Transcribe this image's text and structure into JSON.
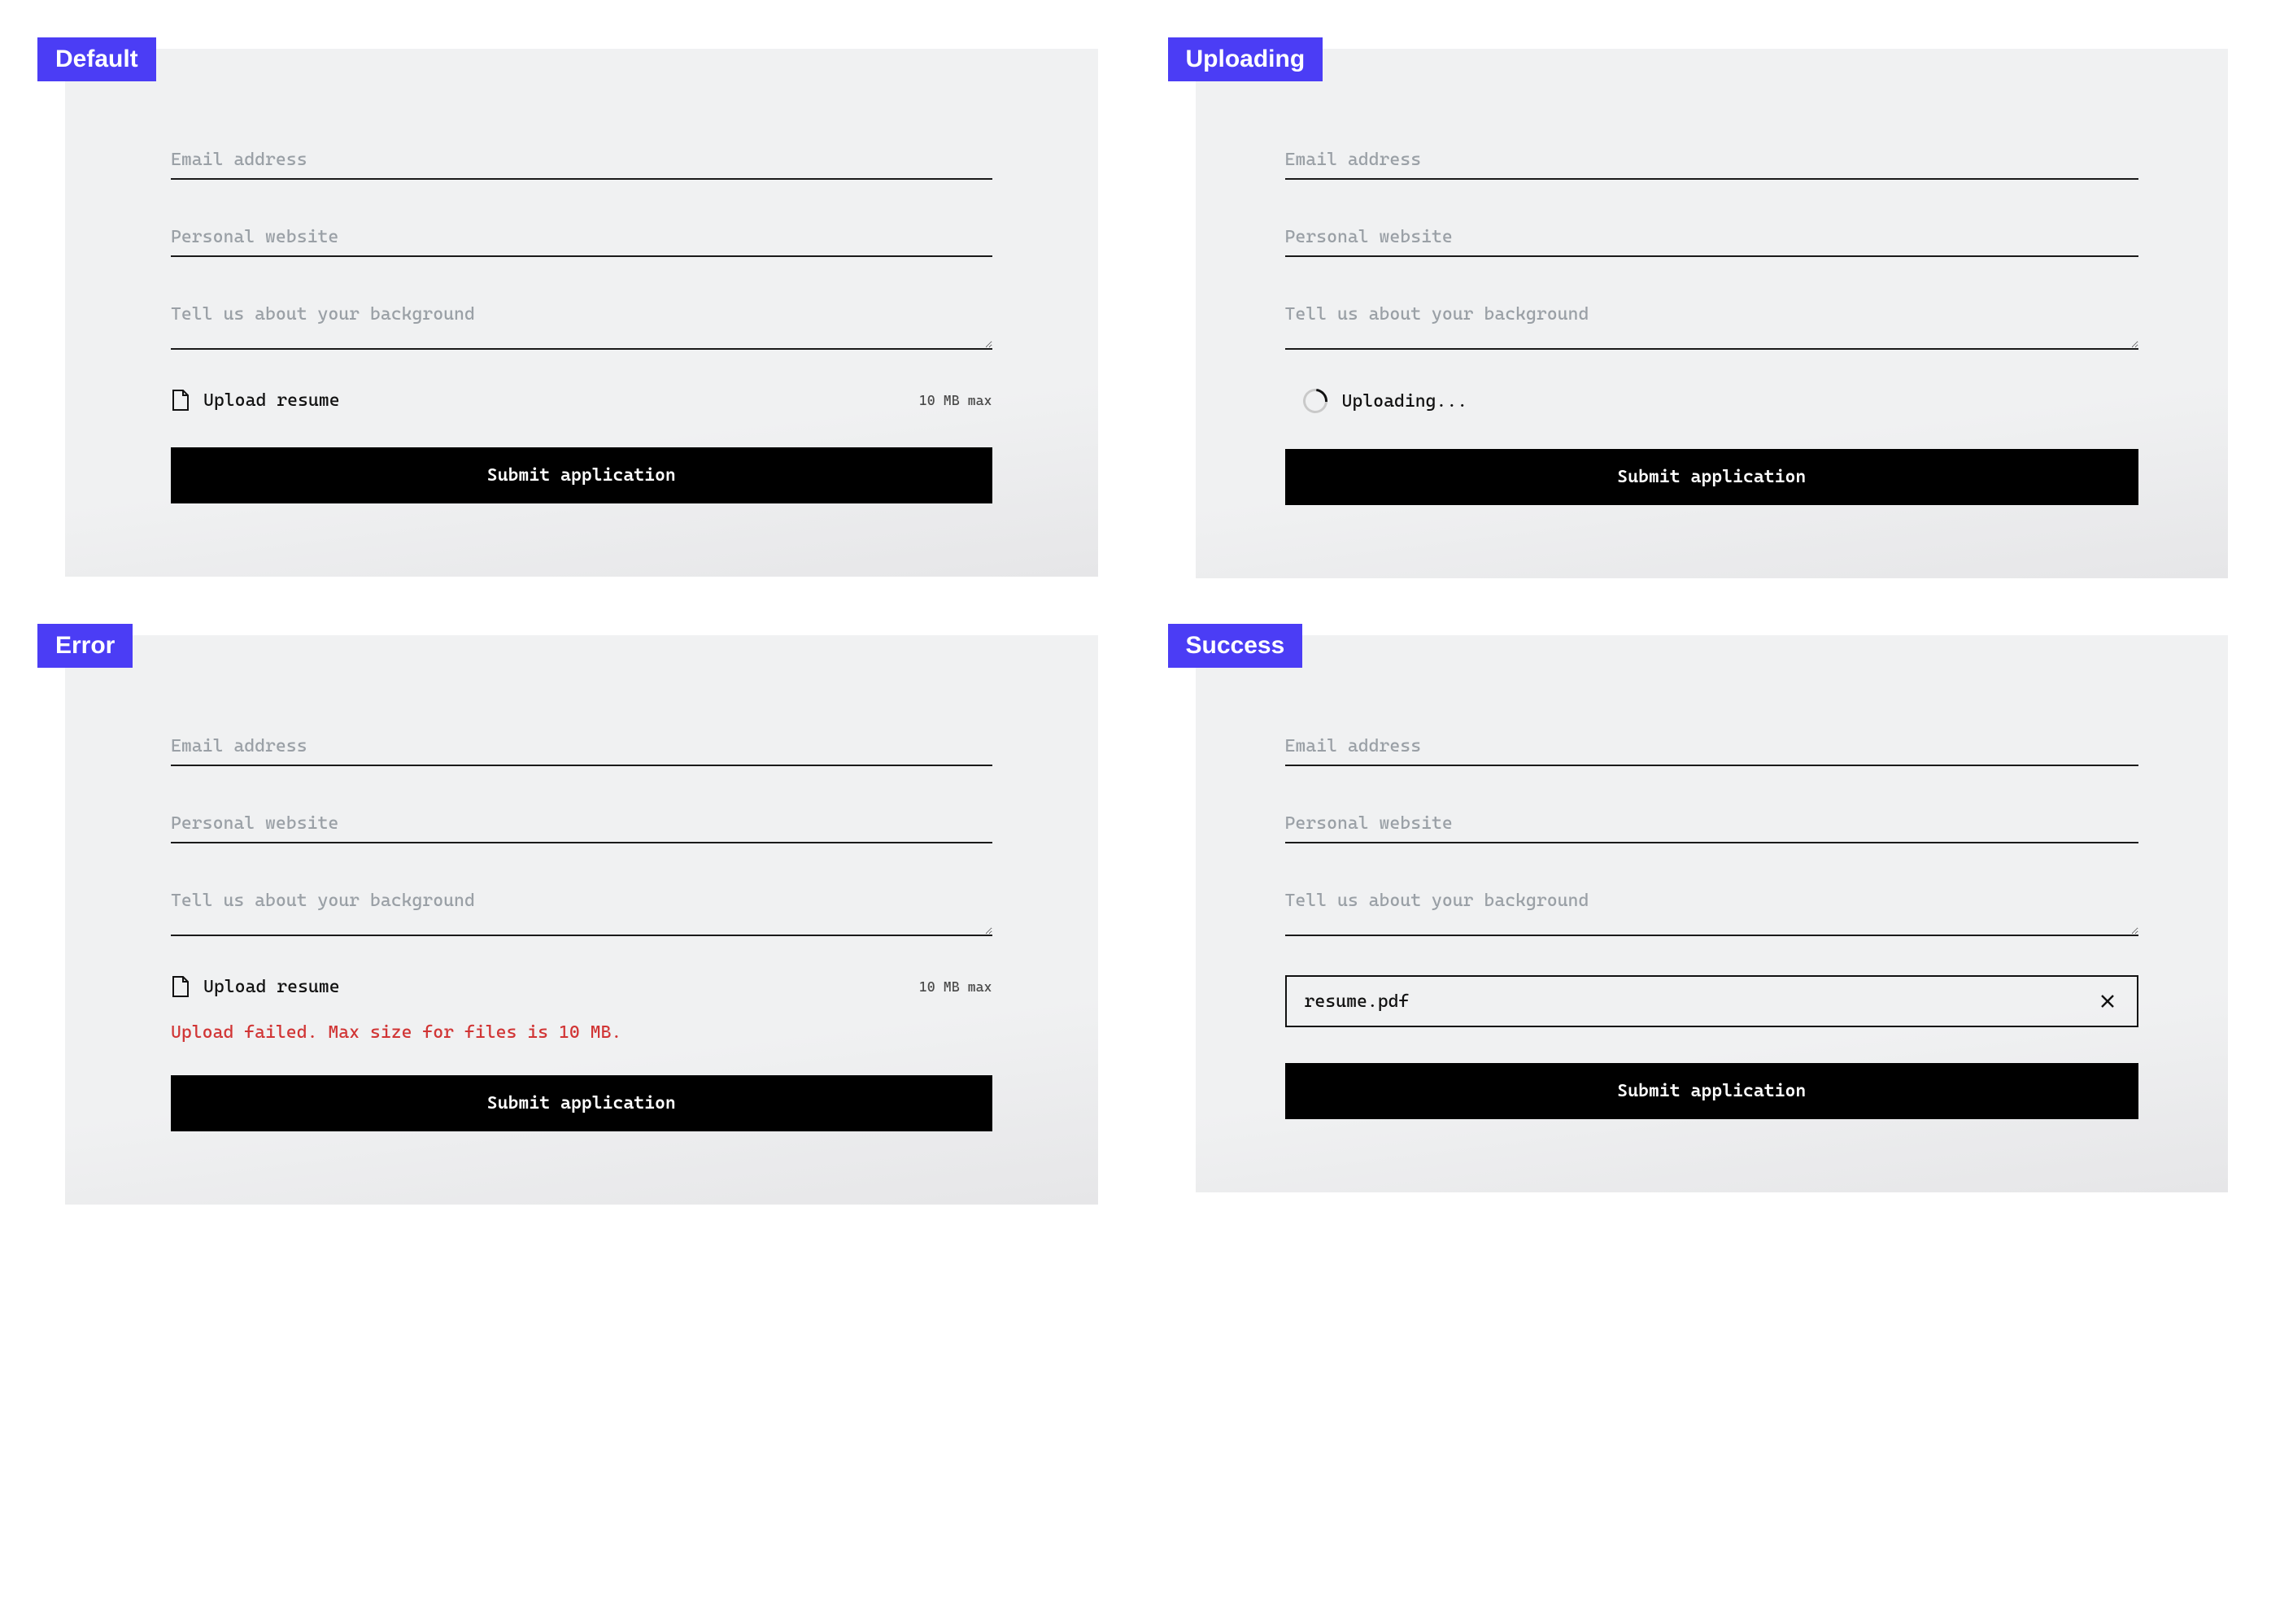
{
  "variants": {
    "default": {
      "tag": "Default",
      "email_placeholder": "Email address",
      "website_placeholder": "Personal website",
      "bio_placeholder": "Tell us about your background",
      "upload_label": "Upload resume",
      "upload_hint": "10 MB max",
      "submit_label": "Submit application"
    },
    "uploading": {
      "tag": "Uploading",
      "email_placeholder": "Email address",
      "website_placeholder": "Personal website",
      "bio_placeholder": "Tell us about your background",
      "status_label": "Uploading...",
      "submit_label": "Submit application"
    },
    "error": {
      "tag": "Error",
      "email_placeholder": "Email address",
      "website_placeholder": "Personal website",
      "bio_placeholder": "Tell us about your background",
      "upload_label": "Upload resume",
      "upload_hint": "10 MB max",
      "error_message": "Upload failed. Max size for files is 10 MB.",
      "submit_label": "Submit application"
    },
    "success": {
      "tag": "Success",
      "email_placeholder": "Email address",
      "website_placeholder": "Personal website",
      "bio_placeholder": "Tell us about your background",
      "file_name": "resume.pdf",
      "submit_label": "Submit application"
    }
  },
  "colors": {
    "accent": "#4b3df5",
    "error": "#d13535",
    "panel": "#f0f1f2",
    "submit_bg": "#000000",
    "submit_fg": "#ffffff"
  }
}
